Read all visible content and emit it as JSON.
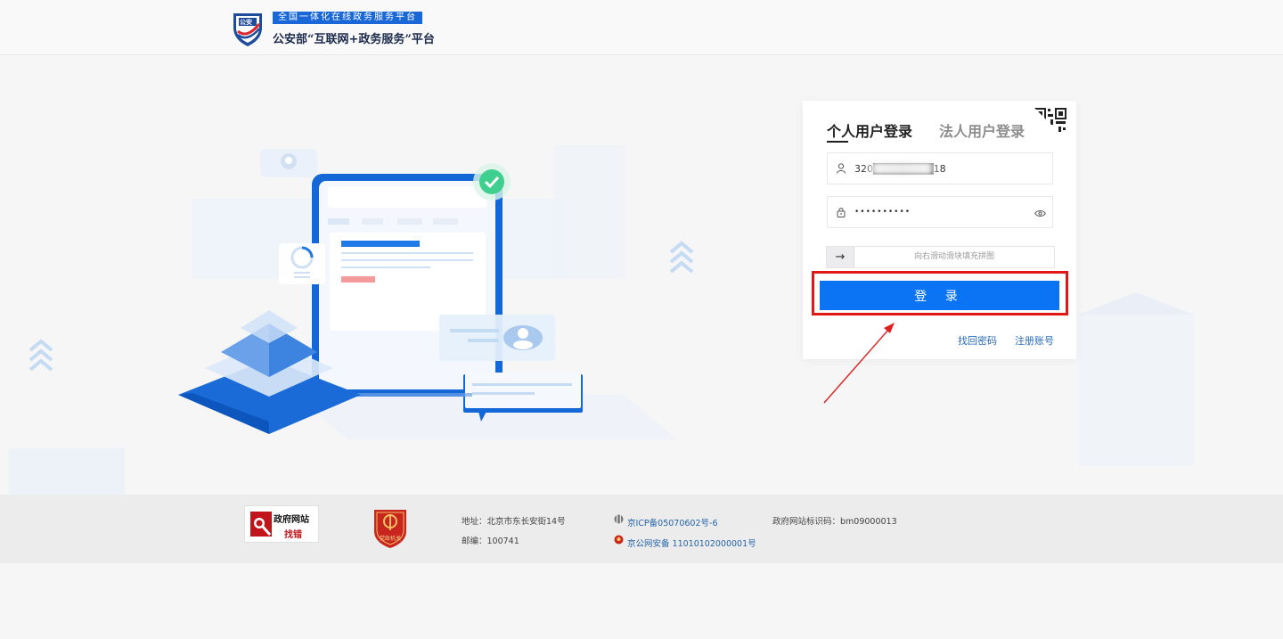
{
  "header": {
    "logo_shield_text": "公安",
    "logo_top": "全国一体化在线政务服务平台",
    "logo_bottom": "公安部“互联网+政务服务”平台"
  },
  "login": {
    "tabs": [
      {
        "label": "个人用户登录",
        "active": true
      },
      {
        "label": "法人用户登录",
        "active": false
      }
    ],
    "username_value": "320████████18",
    "password_value": "••••••••••",
    "slider_hint": "向右滑动滑块填充拼图",
    "slider_handle_icon": "→",
    "login_button": "登 录",
    "find_password": "找回密码",
    "register": "注册账号",
    "icons": {
      "user": "user-icon",
      "lock": "lock-icon",
      "eye": "eye-icon",
      "qr": "qr-code-icon"
    }
  },
  "footer": {
    "gov_badge_line1": "政府网站",
    "gov_badge_line2": "找错",
    "party_badge": "党政机关",
    "address": "地址：北京市东长安街14号",
    "postcode": "邮编：100741",
    "icp": "京ICP备05070602号-6",
    "police_record": "京公网安备 11010102000001号",
    "site_id": "政府网站标识码：bm09000013"
  },
  "colors": {
    "primary": "#0a74f5",
    "highlight": "#e21818",
    "link": "#2a6bb8",
    "logo_blue": "#1a68d8"
  }
}
